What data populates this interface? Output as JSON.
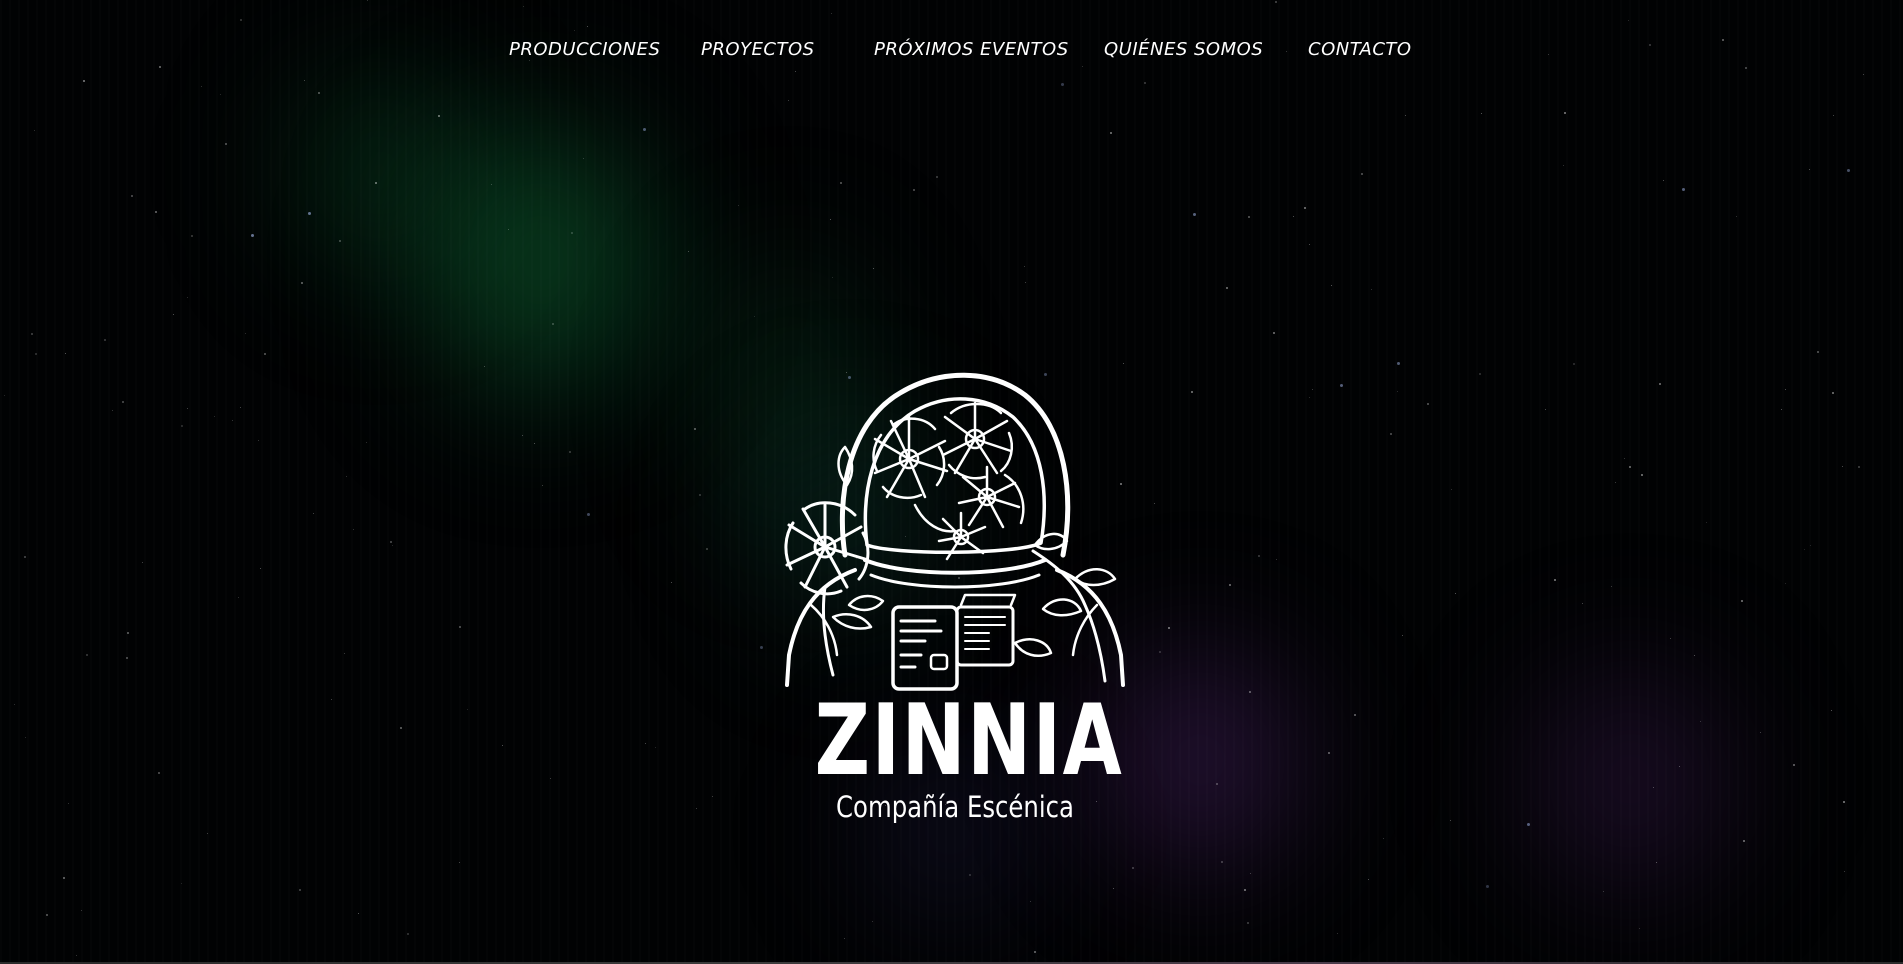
{
  "nav": {
    "items": [
      {
        "label": "PRODUCCIONES"
      },
      {
        "label": "PROYECTOS"
      },
      {
        "label": "PRÓXIMOS EVENTOS"
      },
      {
        "label": "QUIÉNES SOMOS"
      },
      {
        "label": "CONTACTO"
      }
    ]
  },
  "logo": {
    "name": "ZINNIA",
    "subtitle": "Compañía Escénica",
    "emblem": "astronaut-with-flowers-icon"
  },
  "colors": {
    "background": "#010203",
    "text": "#ffffff",
    "aurora_green": "#148c46",
    "aurora_purple": "#6e3296"
  }
}
